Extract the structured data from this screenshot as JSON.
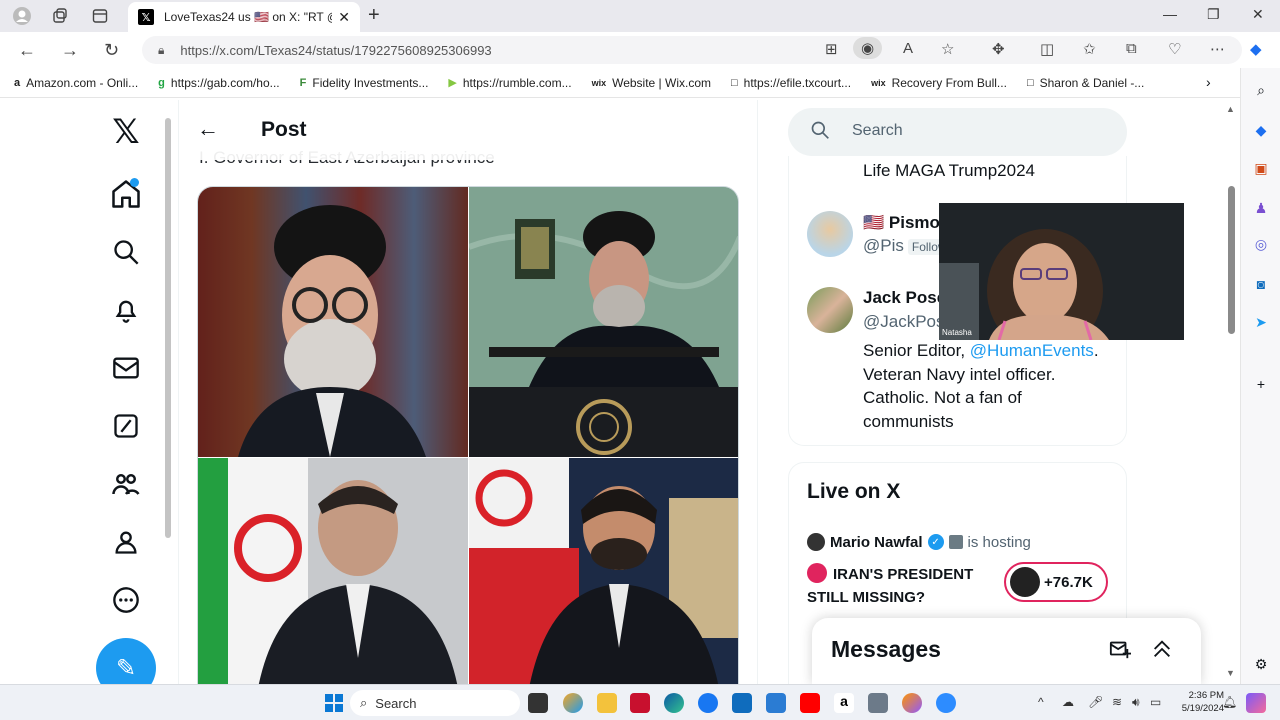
{
  "browser": {
    "tab_title": "LoveTexas24 us 🇺🇸 on X: \"RT @Pi",
    "url": "https://x.com/LTexas24/status/1792275608925306993",
    "bookmarks": [
      {
        "label": "Amazon.com - Onli...",
        "icon": "a"
      },
      {
        "label": "https://gab.com/ho...",
        "icon": "g"
      },
      {
        "label": "Fidelity Investments...",
        "icon": "F"
      },
      {
        "label": "https://rumble.com...",
        "icon": "▶"
      },
      {
        "label": "Website | Wix.com",
        "icon": "wix"
      },
      {
        "label": "https://efile.txcourt...",
        "icon": "□"
      },
      {
        "label": "Recovery From Bull...",
        "icon": "wix"
      },
      {
        "label": "Sharon & Daniel -...",
        "icon": "□"
      }
    ]
  },
  "x": {
    "header_title": "Post",
    "cut_text": "I. Governor of East Azerbaijan province",
    "search_placeholder": "Search",
    "who_to_follow": {
      "bio_top": "Life MAGA Trump2024",
      "user1_name": "🇺🇸 Pismo",
      "user1_handle": "@Pis",
      "user1_follows": "Follow",
      "user2_name": "Jack Pose",
      "user2_handle": "@JackPos",
      "bio_prefix": "Senior Editor, ",
      "bio_link": "@HumanEvents",
      "bio_rest": ". Veteran Navy intel officer. Catholic. Not a fan of communists"
    },
    "live": {
      "title": "Live on X",
      "host_name": "Mario Nawfal",
      "hosting_label": "is hosting",
      "space_title": "IRAN'S PRESIDENT STILL MISSING?",
      "listener_count": "+76.7K"
    },
    "messages_title": "Messages"
  },
  "webcam_label": "Natasha",
  "taskbar": {
    "search_label": "Search",
    "time": "2:36 PM",
    "date": "5/19/2024"
  },
  "colors": {
    "accent": "#1d9bf0",
    "live_red": "#e0245e"
  }
}
